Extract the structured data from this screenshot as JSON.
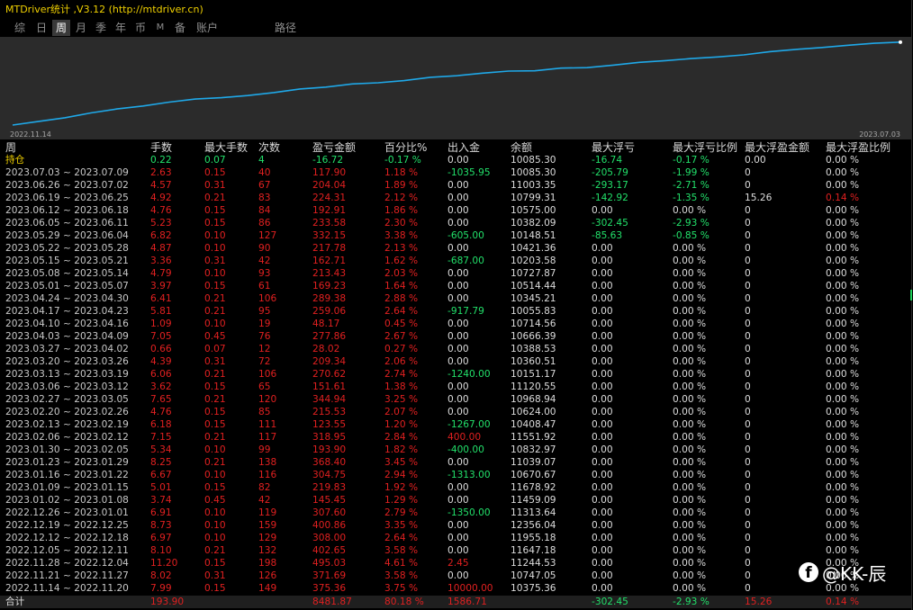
{
  "window": {
    "title": "MTDriver统计 ,V3.12 (http://mtdriver.cn)"
  },
  "tabs": [
    {
      "label": "综",
      "active": false
    },
    {
      "label": "日",
      "active": false
    },
    {
      "label": "周",
      "active": true
    },
    {
      "label": "月",
      "active": false
    },
    {
      "label": "季",
      "active": false
    },
    {
      "label": "年",
      "active": false
    },
    {
      "label": "币",
      "active": false
    },
    {
      "label": "M",
      "active": false
    },
    {
      "label": "备",
      "active": false
    },
    {
      "label": "账户",
      "active": false
    },
    {
      "label": "路径",
      "active": false
    }
  ],
  "equity_chart": {
    "start_label": "2022.11.14",
    "end_label": "2023.07.03",
    "line_color": "#1fa8e8",
    "background": "#2b2b2b"
  },
  "chart_data": {
    "type": "line",
    "title": "",
    "x": [
      "2022.11.14",
      "2022.11.21",
      "2022.11.28",
      "2022.12.05",
      "2022.12.12",
      "2022.12.19",
      "2022.12.26",
      "2023.01.02",
      "2023.01.09",
      "2023.01.16",
      "2023.01.23",
      "2023.01.30",
      "2023.02.06",
      "2023.02.13",
      "2023.02.20",
      "2023.02.27",
      "2023.03.06",
      "2023.03.13",
      "2023.03.20",
      "2023.03.27",
      "2023.04.03",
      "2023.04.10",
      "2023.04.17",
      "2023.04.24",
      "2023.05.01",
      "2023.05.08",
      "2023.05.15",
      "2023.05.22",
      "2023.05.29",
      "2023.06.05",
      "2023.06.12",
      "2023.06.19",
      "2023.06.26",
      "2023.07.03"
    ],
    "values": [
      375.36,
      747.05,
      1244.53,
      1647.18,
      1955.18,
      2356.04,
      2663.64,
      2809.09,
      3028.92,
      3333.67,
      3702.07,
      3896.97,
      4215.92,
      4339.47,
      4555.0,
      4899.87,
      5051.48,
      5322.1,
      5531.44,
      5559.46,
      5837.32,
      5885.49,
      6144.55,
      6433.93,
      6603.16,
      6816.59,
      6979.3,
      7197.08,
      7529.23,
      7762.81,
      7955.72,
      8180.0,
      8384.04,
      8501.94
    ],
    "ylabel": "",
    "xlabel": "",
    "grid": false
  },
  "table": {
    "headers": [
      "周",
      "手数",
      "最大手数",
      "次数",
      "盈亏金额",
      "百分比%",
      "出入金",
      "余额",
      "最大浮亏",
      "最大浮亏比例",
      "最大浮盈金额",
      "最大浮盈比例"
    ],
    "holding": {
      "label": "持仓",
      "lots": "0.22",
      "max_lots": "0.07",
      "trades": "4",
      "pnl": "-16.72",
      "pct": "-0.17 %",
      "flow": "0.00",
      "balance": "10085.30",
      "max_fl": "-16.74",
      "max_fl_pct": "-0.17 %",
      "max_fp": "0.00",
      "max_fp_pct": "0.00 %"
    },
    "rows": [
      {
        "period": "2023.07.03 ~ 2023.07.09",
        "lots": "2.63",
        "max_lots": "0.15",
        "trades": "40",
        "pnl": "117.90",
        "pct": "1.18 %",
        "flow": "-1035.95",
        "balance": "10085.30",
        "max_fl": "-205.79",
        "max_fl_pct": "-1.99 %",
        "max_fp": "0",
        "max_fp_pct": "0.00 %"
      },
      {
        "period": "2023.06.26 ~ 2023.07.02",
        "lots": "4.57",
        "max_lots": "0.31",
        "trades": "67",
        "pnl": "204.04",
        "pct": "1.89 %",
        "flow": "0.00",
        "balance": "11003.35",
        "max_fl": "-293.17",
        "max_fl_pct": "-2.71 %",
        "max_fp": "0",
        "max_fp_pct": "0.00 %"
      },
      {
        "period": "2023.06.19 ~ 2023.06.25",
        "lots": "4.92",
        "max_lots": "0.21",
        "trades": "83",
        "pnl": "224.31",
        "pct": "2.12 %",
        "flow": "0.00",
        "balance": "10799.31",
        "max_fl": "-142.92",
        "max_fl_pct": "-1.35 %",
        "max_fp": "15.26",
        "max_fp_pct": "0.14 %"
      },
      {
        "period": "2023.06.12 ~ 2023.06.18",
        "lots": "4.76",
        "max_lots": "0.15",
        "trades": "84",
        "pnl": "192.91",
        "pct": "1.86 %",
        "flow": "0.00",
        "balance": "10575.00",
        "max_fl": "0.00",
        "max_fl_pct": "0.00 %",
        "max_fp": "0",
        "max_fp_pct": "0.00 %"
      },
      {
        "period": "2023.06.05 ~ 2023.06.11",
        "lots": "5.23",
        "max_lots": "0.15",
        "trades": "86",
        "pnl": "233.58",
        "pct": "2.30 %",
        "flow": "0.00",
        "balance": "10382.09",
        "max_fl": "-302.45",
        "max_fl_pct": "-2.93 %",
        "max_fp": "0",
        "max_fp_pct": "0.00 %"
      },
      {
        "period": "2023.05.29 ~ 2023.06.04",
        "lots": "6.82",
        "max_lots": "0.10",
        "trades": "127",
        "pnl": "332.15",
        "pct": "3.38 %",
        "flow": "-605.00",
        "balance": "10148.51",
        "max_fl": "-85.63",
        "max_fl_pct": "-0.85 %",
        "max_fp": "0",
        "max_fp_pct": "0.00 %"
      },
      {
        "period": "2023.05.22 ~ 2023.05.28",
        "lots": "4.87",
        "max_lots": "0.10",
        "trades": "90",
        "pnl": "217.78",
        "pct": "2.13 %",
        "flow": "0.00",
        "balance": "10421.36",
        "max_fl": "0.00",
        "max_fl_pct": "0.00 %",
        "max_fp": "0",
        "max_fp_pct": "0.00 %"
      },
      {
        "period": "2023.05.15 ~ 2023.05.21",
        "lots": "3.36",
        "max_lots": "0.31",
        "trades": "42",
        "pnl": "162.71",
        "pct": "1.62 %",
        "flow": "-687.00",
        "balance": "10203.58",
        "max_fl": "0.00",
        "max_fl_pct": "0.00 %",
        "max_fp": "0",
        "max_fp_pct": "0.00 %"
      },
      {
        "period": "2023.05.08 ~ 2023.05.14",
        "lots": "4.79",
        "max_lots": "0.10",
        "trades": "93",
        "pnl": "213.43",
        "pct": "2.03 %",
        "flow": "0.00",
        "balance": "10727.87",
        "max_fl": "0.00",
        "max_fl_pct": "0.00 %",
        "max_fp": "0",
        "max_fp_pct": "0.00 %"
      },
      {
        "period": "2023.05.01 ~ 2023.05.07",
        "lots": "3.97",
        "max_lots": "0.15",
        "trades": "61",
        "pnl": "169.23",
        "pct": "1.64 %",
        "flow": "0.00",
        "balance": "10514.44",
        "max_fl": "0.00",
        "max_fl_pct": "0.00 %",
        "max_fp": "0",
        "max_fp_pct": "0.00 %"
      },
      {
        "period": "2023.04.24 ~ 2023.04.30",
        "lots": "6.41",
        "max_lots": "0.21",
        "trades": "106",
        "pnl": "289.38",
        "pct": "2.88 %",
        "flow": "0.00",
        "balance": "10345.21",
        "max_fl": "0.00",
        "max_fl_pct": "0.00 %",
        "max_fp": "0",
        "max_fp_pct": "0.00 %"
      },
      {
        "period": "2023.04.17 ~ 2023.04.23",
        "lots": "5.81",
        "max_lots": "0.21",
        "trades": "95",
        "pnl": "259.06",
        "pct": "2.64 %",
        "flow": "-917.79",
        "balance": "10055.83",
        "max_fl": "0.00",
        "max_fl_pct": "0.00 %",
        "max_fp": "0",
        "max_fp_pct": "0.00 %"
      },
      {
        "period": "2023.04.10 ~ 2023.04.16",
        "lots": "1.09",
        "max_lots": "0.10",
        "trades": "19",
        "pnl": "48.17",
        "pct": "0.45 %",
        "flow": "0.00",
        "balance": "10714.56",
        "max_fl": "0.00",
        "max_fl_pct": "0.00 %",
        "max_fp": "0",
        "max_fp_pct": "0.00 %"
      },
      {
        "period": "2023.04.03 ~ 2023.04.09",
        "lots": "7.05",
        "max_lots": "0.45",
        "trades": "76",
        "pnl": "277.86",
        "pct": "2.67 %",
        "flow": "0.00",
        "balance": "10666.39",
        "max_fl": "0.00",
        "max_fl_pct": "0.00 %",
        "max_fp": "0",
        "max_fp_pct": "0.00 %"
      },
      {
        "period": "2023.03.27 ~ 2023.04.02",
        "lots": "0.66",
        "max_lots": "0.07",
        "trades": "12",
        "pnl": "28.02",
        "pct": "0.27 %",
        "flow": "0.00",
        "balance": "10388.53",
        "max_fl": "0.00",
        "max_fl_pct": "0.00 %",
        "max_fp": "0",
        "max_fp_pct": "0.00 %"
      },
      {
        "period": "2023.03.20 ~ 2023.03.26",
        "lots": "4.39",
        "max_lots": "0.31",
        "trades": "72",
        "pnl": "209.34",
        "pct": "2.06 %",
        "flow": "0.00",
        "balance": "10360.51",
        "max_fl": "0.00",
        "max_fl_pct": "0.00 %",
        "max_fp": "0",
        "max_fp_pct": "0.00 %"
      },
      {
        "period": "2023.03.13 ~ 2023.03.19",
        "lots": "6.06",
        "max_lots": "0.21",
        "trades": "106",
        "pnl": "270.62",
        "pct": "2.74 %",
        "flow": "-1240.00",
        "balance": "10151.17",
        "max_fl": "0.00",
        "max_fl_pct": "0.00 %",
        "max_fp": "0",
        "max_fp_pct": "0.00 %"
      },
      {
        "period": "2023.03.06 ~ 2023.03.12",
        "lots": "3.62",
        "max_lots": "0.15",
        "trades": "65",
        "pnl": "151.61",
        "pct": "1.38 %",
        "flow": "0.00",
        "balance": "11120.55",
        "max_fl": "0.00",
        "max_fl_pct": "0.00 %",
        "max_fp": "0",
        "max_fp_pct": "0.00 %"
      },
      {
        "period": "2023.02.27 ~ 2023.03.05",
        "lots": "7.65",
        "max_lots": "0.21",
        "trades": "120",
        "pnl": "344.94",
        "pct": "3.25 %",
        "flow": "0.00",
        "balance": "10968.94",
        "max_fl": "0.00",
        "max_fl_pct": "0.00 %",
        "max_fp": "0",
        "max_fp_pct": "0.00 %"
      },
      {
        "period": "2023.02.20 ~ 2023.02.26",
        "lots": "4.76",
        "max_lots": "0.15",
        "trades": "85",
        "pnl": "215.53",
        "pct": "2.07 %",
        "flow": "0.00",
        "balance": "10624.00",
        "max_fl": "0.00",
        "max_fl_pct": "0.00 %",
        "max_fp": "0",
        "max_fp_pct": "0.00 %"
      },
      {
        "period": "2023.02.13 ~ 2023.02.19",
        "lots": "6.18",
        "max_lots": "0.15",
        "trades": "111",
        "pnl": "123.55",
        "pct": "1.20 %",
        "flow": "-1267.00",
        "balance": "10408.47",
        "max_fl": "0.00",
        "max_fl_pct": "0.00 %",
        "max_fp": "0",
        "max_fp_pct": "0.00 %"
      },
      {
        "period": "2023.02.06 ~ 2023.02.12",
        "lots": "7.15",
        "max_lots": "0.21",
        "trades": "117",
        "pnl": "318.95",
        "pct": "2.84 %",
        "flow": "400.00",
        "balance": "11551.92",
        "max_fl": "0.00",
        "max_fl_pct": "0.00 %",
        "max_fp": "0",
        "max_fp_pct": "0.00 %"
      },
      {
        "period": "2023.01.30 ~ 2023.02.05",
        "lots": "5.34",
        "max_lots": "0.10",
        "trades": "99",
        "pnl": "193.90",
        "pct": "1.82 %",
        "flow": "-400.00",
        "balance": "10832.97",
        "max_fl": "0.00",
        "max_fl_pct": "0.00 %",
        "max_fp": "0",
        "max_fp_pct": "0.00 %"
      },
      {
        "period": "2023.01.23 ~ 2023.01.29",
        "lots": "8.25",
        "max_lots": "0.21",
        "trades": "138",
        "pnl": "368.40",
        "pct": "3.45 %",
        "flow": "0.00",
        "balance": "11039.07",
        "max_fl": "0.00",
        "max_fl_pct": "0.00 %",
        "max_fp": "0",
        "max_fp_pct": "0.00 %"
      },
      {
        "period": "2023.01.16 ~ 2023.01.22",
        "lots": "6.67",
        "max_lots": "0.10",
        "trades": "116",
        "pnl": "304.75",
        "pct": "2.94 %",
        "flow": "-1313.00",
        "balance": "10670.67",
        "max_fl": "0.00",
        "max_fl_pct": "0.00 %",
        "max_fp": "0",
        "max_fp_pct": "0.00 %"
      },
      {
        "period": "2023.01.09 ~ 2023.01.15",
        "lots": "5.01",
        "max_lots": "0.15",
        "trades": "82",
        "pnl": "219.83",
        "pct": "1.92 %",
        "flow": "0.00",
        "balance": "11678.92",
        "max_fl": "0.00",
        "max_fl_pct": "0.00 %",
        "max_fp": "0",
        "max_fp_pct": "0.00 %"
      },
      {
        "period": "2023.01.02 ~ 2023.01.08",
        "lots": "3.74",
        "max_lots": "0.45",
        "trades": "42",
        "pnl": "145.45",
        "pct": "1.29 %",
        "flow": "0.00",
        "balance": "11459.09",
        "max_fl": "0.00",
        "max_fl_pct": "0.00 %",
        "max_fp": "0",
        "max_fp_pct": "0.00 %"
      },
      {
        "period": "2022.12.26 ~ 2023.01.01",
        "lots": "6.91",
        "max_lots": "0.10",
        "trades": "119",
        "pnl": "307.60",
        "pct": "2.79 %",
        "flow": "-1350.00",
        "balance": "11313.64",
        "max_fl": "0.00",
        "max_fl_pct": "0.00 %",
        "max_fp": "0",
        "max_fp_pct": "0.00 %"
      },
      {
        "period": "2022.12.19 ~ 2022.12.25",
        "lots": "8.73",
        "max_lots": "0.10",
        "trades": "159",
        "pnl": "400.86",
        "pct": "3.35 %",
        "flow": "0.00",
        "balance": "12356.04",
        "max_fl": "0.00",
        "max_fl_pct": "0.00 %",
        "max_fp": "0",
        "max_fp_pct": "0.00 %"
      },
      {
        "period": "2022.12.12 ~ 2022.12.18",
        "lots": "6.97",
        "max_lots": "0.10",
        "trades": "129",
        "pnl": "308.00",
        "pct": "2.64 %",
        "flow": "0.00",
        "balance": "11955.18",
        "max_fl": "0.00",
        "max_fl_pct": "0.00 %",
        "max_fp": "0",
        "max_fp_pct": "0.00 %"
      },
      {
        "period": "2022.12.05 ~ 2022.12.11",
        "lots": "8.10",
        "max_lots": "0.21",
        "trades": "132",
        "pnl": "402.65",
        "pct": "3.58 %",
        "flow": "0.00",
        "balance": "11647.18",
        "max_fl": "0.00",
        "max_fl_pct": "0.00 %",
        "max_fp": "0",
        "max_fp_pct": "0.00 %"
      },
      {
        "period": "2022.11.28 ~ 2022.12.04",
        "lots": "11.20",
        "max_lots": "0.15",
        "trades": "198",
        "pnl": "495.03",
        "pct": "4.61 %",
        "flow": "2.45",
        "balance": "11244.53",
        "max_fl": "0.00",
        "max_fl_pct": "0.00 %",
        "max_fp": "0",
        "max_fp_pct": "0.00 %"
      },
      {
        "period": "2022.11.21 ~ 2022.11.27",
        "lots": "8.02",
        "max_lots": "0.31",
        "trades": "126",
        "pnl": "371.69",
        "pct": "3.58 %",
        "flow": "0.00",
        "balance": "10747.05",
        "max_fl": "0.00",
        "max_fl_pct": "0.00 %",
        "max_fp": "0",
        "max_fp_pct": "0.00 %"
      },
      {
        "period": "2022.11.14 ~ 2022.11.20",
        "lots": "7.99",
        "max_lots": "0.15",
        "trades": "149",
        "pnl": "375.36",
        "pct": "3.75 %",
        "flow": "10000.00",
        "balance": "10375.36",
        "max_fl": "0.00",
        "max_fl_pct": "0.00 %",
        "max_fp": "0",
        "max_fp_pct": "0.00 %"
      }
    ],
    "summary": {
      "label": "合计",
      "lots": "193.90",
      "pnl": "8481.87",
      "pct": "80.18 %",
      "flow": "1586.71",
      "max_fl": "-302.45",
      "max_fl_pct": "-2.93 %",
      "max_fp": "15.26",
      "max_fp_pct": "0.14 %"
    }
  },
  "watermark": {
    "text": "@KK-辰",
    "icon": "facebook-icon"
  },
  "colors": {
    "positive": "#e02020",
    "negative": "#22e06a",
    "neutral": "#dcdcdc",
    "title": "#f0d000",
    "header": "#d8d8d8"
  }
}
